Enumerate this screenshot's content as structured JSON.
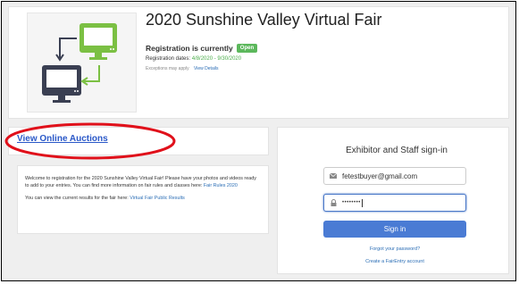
{
  "fair": {
    "title": "2020 Sunshine Valley Virtual Fair",
    "registration_label": "Registration is currently",
    "status_badge": "Open",
    "dates_label": "Registration dates:",
    "dates_range": "4/8/2020 - 9/30/2020",
    "exceptions_text": "Exceptions may apply",
    "view_details_link": "View Details"
  },
  "auctions": {
    "link_label": "View Online Auctions",
    "highlight_color": "#e0101a"
  },
  "welcome": {
    "paragraph1_text": "Welcome to registration for the 2020 Sunshine Valley Virtual Fair! Please have your photos and videos ready to add to your entries. You can find more information on fair rules and classes here: ",
    "paragraph1_link": "Fair Rules 2020",
    "paragraph2_text": "You can view the current results for the fair here: ",
    "paragraph2_link": "Virtual Fair Public Results"
  },
  "signin": {
    "title": "Exhibitor and Staff sign-in",
    "email_value": "fetestbuyer@gmail.com",
    "password_masked": "••••••••",
    "button_label": "Sign in",
    "forgot_link": "Forgot your password?",
    "create_link": "Create a FairEntry account"
  },
  "colors": {
    "accent_blue": "#4a7bd4",
    "link_blue": "#2a6db5",
    "open_green": "#5cb85c",
    "logo_green": "#7bc043",
    "logo_dark": "#3a3f52"
  }
}
